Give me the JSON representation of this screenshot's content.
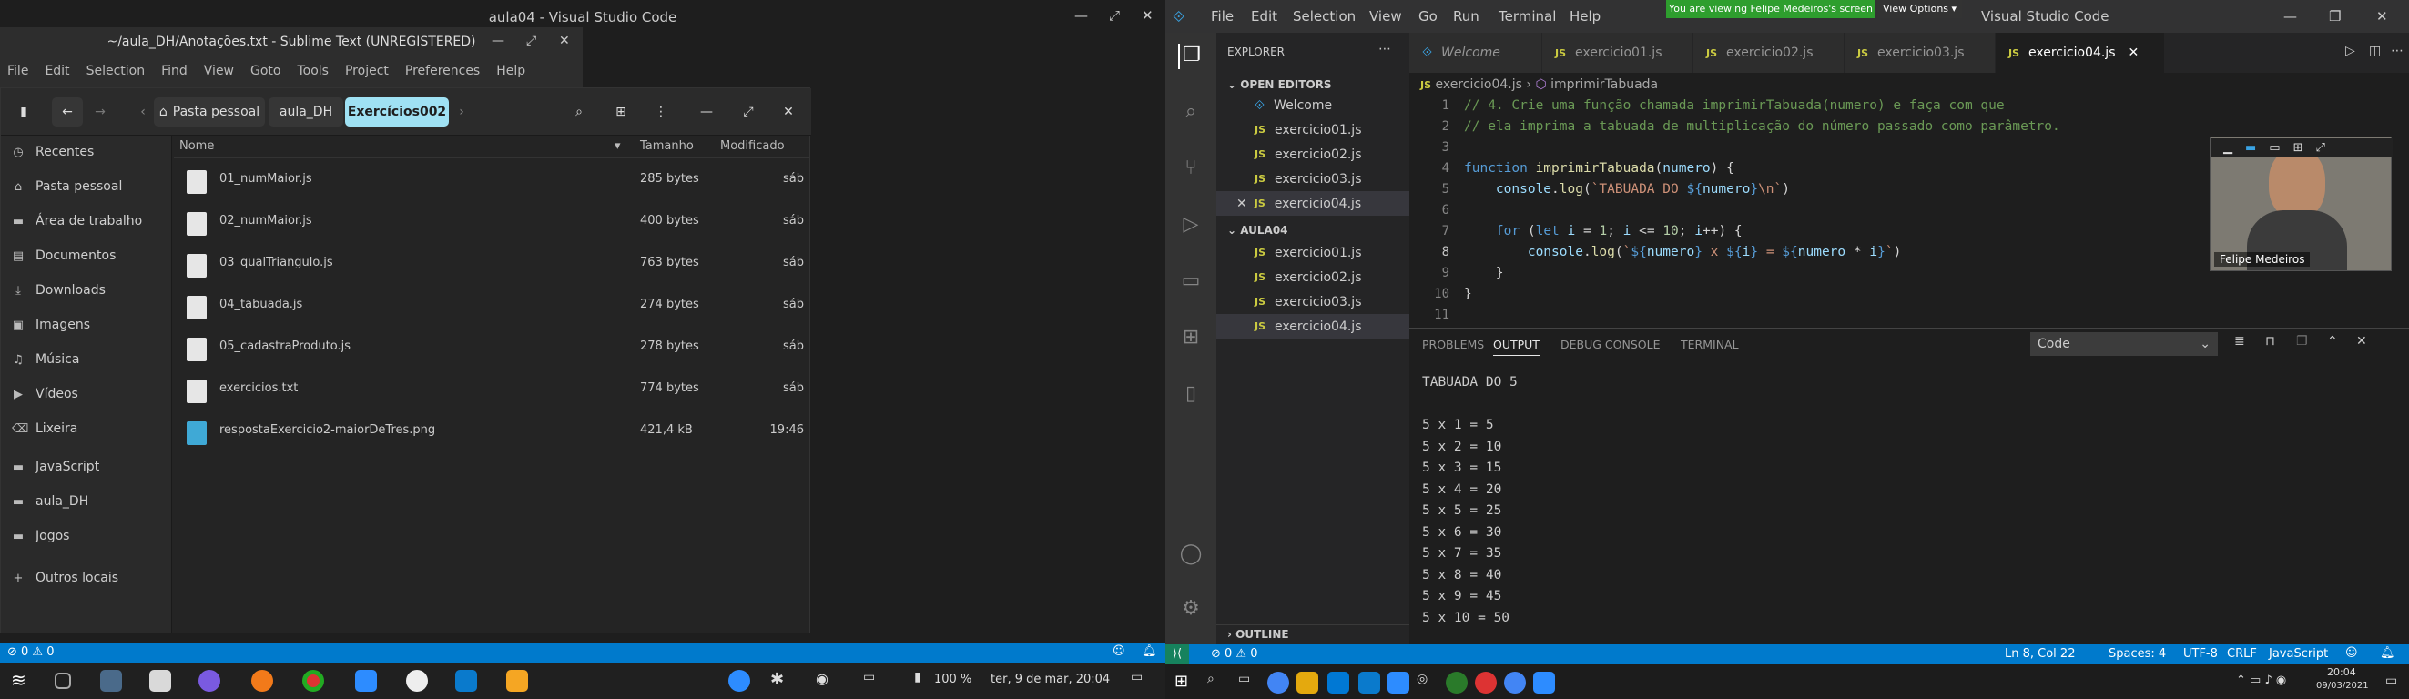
{
  "left_screen": {
    "title": "aula04 - Visual Studio Code",
    "sublime": {
      "title": "~/aula_DH/Anotações.txt - Sublime Text (UNREGISTERED)",
      "menu": [
        "File",
        "Edit",
        "Selection",
        "Find",
        "View",
        "Goto",
        "Tools",
        "Project",
        "Preferences",
        "Help"
      ]
    },
    "files": {
      "breadcrumb": [
        "Pasta pessoal",
        "aula_DH",
        "Exercícios002"
      ],
      "sidebar": [
        "Recentes",
        "Pasta pessoal",
        "Área de trabalho",
        "Documentos",
        "Downloads",
        "Imagens",
        "Música",
        "Vídeos",
        "Lixeira",
        "JavaScript",
        "aula_DH",
        "Jogos",
        "Outros locais"
      ],
      "columns": {
        "name": "Nome",
        "size": "Tamanho",
        "modified": "Modificado"
      },
      "rows": [
        {
          "name": "01_numMaior.js",
          "size": "285 bytes",
          "modified": "sáb"
        },
        {
          "name": "02_numMaior.js",
          "size": "400 bytes",
          "modified": "sáb"
        },
        {
          "name": "03_qualTriangulo.js",
          "size": "763 bytes",
          "modified": "sáb"
        },
        {
          "name": "04_tabuada.js",
          "size": "274 bytes",
          "modified": "sáb"
        },
        {
          "name": "05_cadastraProduto.js",
          "size": "278 bytes",
          "modified": "sáb"
        },
        {
          "name": "exercicios.txt",
          "size": "774 bytes",
          "modified": "sáb"
        },
        {
          "name": "respostaExercicio2-maiorDeTres.png",
          "size": "421,4 kB",
          "modified": "19:46"
        }
      ]
    },
    "status": {
      "problems": "⊘ 0 ⚠ 0"
    },
    "taskbar": {
      "volume": "100 %",
      "datetime": "ter, 9 de mar, 20:04"
    }
  },
  "right_screen": {
    "menu": [
      "File",
      "Edit",
      "Selection",
      "View",
      "Go",
      "Run",
      "Terminal",
      "Help"
    ],
    "share_banner": "You are viewing Felipe Medeiros's screen",
    "view_options": "View Options ▾",
    "title_tail": "Visual Studio Code",
    "explorer": {
      "title": "EXPLORER",
      "open_editors_header": "OPEN EDITORS",
      "open_editors": [
        "Welcome",
        "exercicio01.js",
        "exercicio02.js",
        "exercicio03.js",
        "exercicio04.js"
      ],
      "folder_header": "AULA04",
      "folder_files": [
        "exercicio01.js",
        "exercicio02.js",
        "exercicio03.js",
        "exercicio04.js"
      ],
      "outline": "OUTLINE"
    },
    "tabs": [
      "Welcome",
      "exercicio01.js",
      "exercicio02.js",
      "exercicio03.js",
      "exercicio04.js"
    ],
    "breadcrumb": {
      "file": "exercicio04.js",
      "symbol": "imprimirTabuada"
    },
    "code_lines": [
      "1",
      "2",
      "3",
      "4",
      "5",
      "6",
      "7",
      "8",
      "9",
      "10",
      "11"
    ],
    "code_comment1": "// 4. Crie uma função chamada imprimirTabuada(numero) e faça com que",
    "code_comment2": "// ela imprima a tabuada de multiplicação do número passado como parâmetro.",
    "panel": {
      "tabs": [
        "PROBLEMS",
        "OUTPUT",
        "DEBUG CONSOLE",
        "TERMINAL"
      ],
      "dropdown": "Code",
      "output": [
        "TABUADA DO 5",
        "",
        "5 x 1 = 5",
        "5 x 2 = 10",
        "5 x 3 = 15",
        "5 x 4 = 20",
        "5 x 5 = 25",
        "5 x 6 = 30",
        "5 x 7 = 35",
        "5 x 8 = 40",
        "5 x 9 = 45",
        "5 x 10 = 50"
      ]
    },
    "camera_name": "Felipe Medeiros",
    "status": {
      "problems": "⊘ 0 ⚠ 0",
      "position": "Ln 8, Col 22",
      "spaces": "Spaces: 4",
      "encoding": "UTF-8",
      "eol": "CRLF",
      "language": "JavaScript"
    },
    "clock": {
      "time": "20:04",
      "date": "09/03/2021"
    }
  }
}
